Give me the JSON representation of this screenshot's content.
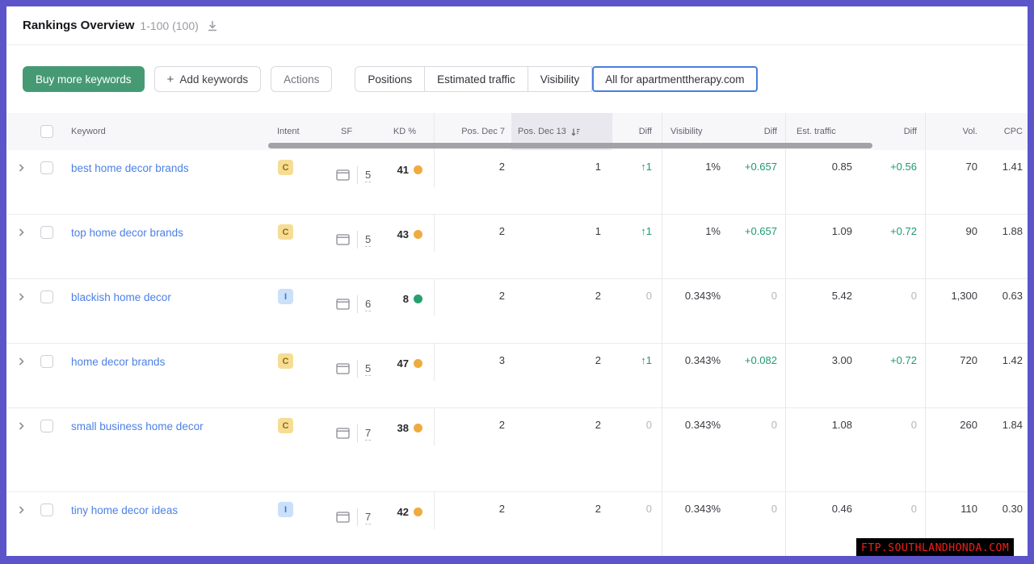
{
  "header": {
    "title": "Rankings Overview",
    "range": "1-100 (100)"
  },
  "toolbar": {
    "buy_label": "Buy more keywords",
    "add_label": "Add keywords",
    "add_plus": "+",
    "actions_label": "Actions",
    "tabs": [
      {
        "label": "Positions",
        "selected": false
      },
      {
        "label": "Estimated traffic",
        "selected": false
      },
      {
        "label": "Visibility",
        "selected": false
      },
      {
        "label": "All for apartmenttherapy.com",
        "selected": true
      }
    ]
  },
  "table": {
    "columns": {
      "keyword": "Keyword",
      "intent": "Intent",
      "sf": "SF",
      "kd": "KD %",
      "pos_prev": "Pos. Dec 7",
      "pos_cur": "Pos. Dec 13",
      "diff": "Diff",
      "visibility": "Visibility",
      "est_traffic": "Est. traffic",
      "vol": "Vol.",
      "cpc": "CPC"
    },
    "rows": [
      {
        "keyword": "best home decor brands",
        "intent": {
          "label": "C",
          "type": "commercial"
        },
        "serp_features": "5",
        "kd": {
          "value": "41",
          "level": "medium"
        },
        "pos_prev": "2",
        "pos_cur": "1",
        "pos_diff": {
          "value": "↑1",
          "trend": "up"
        },
        "visibility": "1%",
        "visibility_diff": {
          "value": "+0.657",
          "trend": "up"
        },
        "est_traffic": "0.85",
        "traffic_diff": {
          "value": "+0.56",
          "trend": "up"
        },
        "volume": "70",
        "cpc": "1.41"
      },
      {
        "keyword": "top home decor brands",
        "intent": {
          "label": "C",
          "type": "commercial"
        },
        "serp_features": "5",
        "kd": {
          "value": "43",
          "level": "medium"
        },
        "pos_prev": "2",
        "pos_cur": "1",
        "pos_diff": {
          "value": "↑1",
          "trend": "up"
        },
        "visibility": "1%",
        "visibility_diff": {
          "value": "+0.657",
          "trend": "up"
        },
        "est_traffic": "1.09",
        "traffic_diff": {
          "value": "+0.72",
          "trend": "up"
        },
        "volume": "90",
        "cpc": "1.88"
      },
      {
        "keyword": "blackish home decor",
        "intent": {
          "label": "I",
          "type": "informational"
        },
        "serp_features": "6",
        "kd": {
          "value": "8",
          "level": "easy"
        },
        "pos_prev": "2",
        "pos_cur": "2",
        "pos_diff": {
          "value": "0",
          "trend": "none"
        },
        "visibility": "0.343%",
        "visibility_diff": {
          "value": "0",
          "trend": "none"
        },
        "est_traffic": "5.42",
        "traffic_diff": {
          "value": "0",
          "trend": "none"
        },
        "volume": "1,300",
        "cpc": "0.63"
      },
      {
        "keyword": "home decor brands",
        "intent": {
          "label": "C",
          "type": "commercial"
        },
        "serp_features": "5",
        "kd": {
          "value": "47",
          "level": "medium"
        },
        "pos_prev": "3",
        "pos_cur": "2",
        "pos_diff": {
          "value": "↑1",
          "trend": "up"
        },
        "visibility": "0.343%",
        "visibility_diff": {
          "value": "+0.082",
          "trend": "up"
        },
        "est_traffic": "3.00",
        "traffic_diff": {
          "value": "+0.72",
          "trend": "up"
        },
        "volume": "720",
        "cpc": "1.42"
      },
      {
        "keyword": "small business home decor",
        "intent": {
          "label": "C",
          "type": "commercial"
        },
        "serp_features": "7",
        "kd": {
          "value": "38",
          "level": "medium"
        },
        "pos_prev": "2",
        "pos_cur": "2",
        "pos_diff": {
          "value": "0",
          "trend": "none"
        },
        "visibility": "0.343%",
        "visibility_diff": {
          "value": "0",
          "trend": "none"
        },
        "est_traffic": "1.08",
        "traffic_diff": {
          "value": "0",
          "trend": "none"
        },
        "volume": "260",
        "cpc": "1.84"
      },
      {
        "keyword": "tiny home decor ideas",
        "intent": {
          "label": "I",
          "type": "informational"
        },
        "serp_features": "7",
        "kd": {
          "value": "42",
          "level": "medium"
        },
        "pos_prev": "2",
        "pos_cur": "2",
        "pos_diff": {
          "value": "0",
          "trend": "none"
        },
        "visibility": "0.343%",
        "visibility_diff": {
          "value": "0",
          "trend": "none"
        },
        "est_traffic": "0.46",
        "traffic_diff": {
          "value": "0",
          "trend": "none"
        },
        "volume": "110",
        "cpc": "0.30"
      }
    ]
  },
  "watermark": "FTP.SOUTHLANDHONDA.COM",
  "colors": {
    "frame_border": "#5b55c9",
    "buy_button": "#459a74",
    "selected_tab_border": "#4a7de0",
    "keyword_link": "#4c80e6",
    "positive_diff": "#1f9a6e",
    "neutral_diff": "#b6b6bc",
    "kd_medium_dot": "#efab3f",
    "kd_easy_dot": "#27a06e",
    "intent_commercial_bg": "#f6dd93",
    "intent_informational_bg": "#cbe0f9",
    "watermark_text": "#ef2016"
  }
}
